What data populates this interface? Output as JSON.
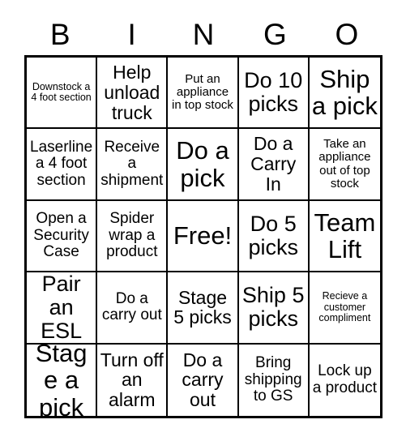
{
  "card": {
    "title_letters": [
      "B",
      "I",
      "N",
      "G",
      "O"
    ],
    "free_space_label": "Free!",
    "colors": {
      "background": "#ffffff",
      "border": "#000000",
      "text": "#000000"
    },
    "grid": {
      "rows": 5,
      "columns": 5
    },
    "cells": [
      {
        "text": "Downstock a 4 foot section",
        "size": "xs"
      },
      {
        "text": "Help unload truck",
        "size": "lg"
      },
      {
        "text": "Put an appliance in top stock",
        "size": "sm"
      },
      {
        "text": "Do 10 picks",
        "size": "xl"
      },
      {
        "text": "Ship a pick",
        "size": "xxl"
      },
      {
        "text": "Laserline a 4 foot section",
        "size": "md"
      },
      {
        "text": "Receive a shipment",
        "size": "md"
      },
      {
        "text": "Do a pick",
        "size": "xxl"
      },
      {
        "text": "Do a Carry In",
        "size": "lg"
      },
      {
        "text": "Take an appliance out of top stock",
        "size": "sm"
      },
      {
        "text": "Open a Security Case",
        "size": "md"
      },
      {
        "text": "Spider wrap a product",
        "size": "md"
      },
      {
        "text": "Free!",
        "size": "xxl"
      },
      {
        "text": "Do 5 picks",
        "size": "xl"
      },
      {
        "text": "Team Lift",
        "size": "xxl"
      },
      {
        "text": "Pair an ESL",
        "size": "xl"
      },
      {
        "text": "Do a carry out",
        "size": "md"
      },
      {
        "text": "Stage 5 picks",
        "size": "lg"
      },
      {
        "text": "Ship 5 picks",
        "size": "xl"
      },
      {
        "text": "Recieve a customer compliment",
        "size": "xs"
      },
      {
        "text": "Stage a pick",
        "size": "xxl"
      },
      {
        "text": "Turn off an alarm",
        "size": "lg"
      },
      {
        "text": "Do a carry out",
        "size": "lg"
      },
      {
        "text": "Bring shipping to GS",
        "size": "md"
      },
      {
        "text": "Lock up a product",
        "size": "md"
      }
    ]
  }
}
